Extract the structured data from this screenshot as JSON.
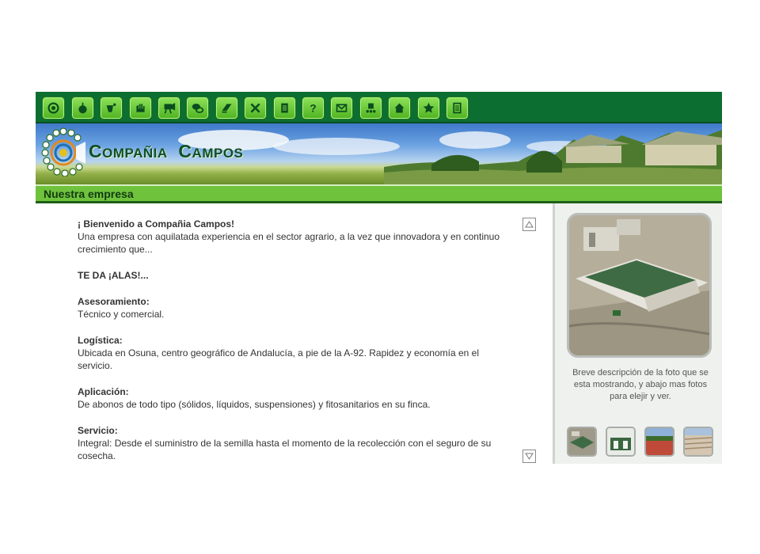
{
  "toolbar": {
    "icons": [
      "cc-logo-icon",
      "apple-icon",
      "tractor-icon",
      "glove-icon",
      "projector-icon",
      "chat-icon",
      "book-icon",
      "tools-icon",
      "document-icon",
      "help-icon",
      "mail-icon",
      "team-icon",
      "home-icon",
      "star-icon",
      "list-icon"
    ]
  },
  "banner": {
    "brand_1": "C",
    "brand_1_rest": "OMPAÑIA",
    "brand_2": "C",
    "brand_2_rest": "AMPOS"
  },
  "section": {
    "title": "Nuestra empresa"
  },
  "content": {
    "welcome_title": "¡ Bienvenido a Compañia Campos!",
    "welcome_text": "Una empresa con aquilatada experiencia en el sector agrario, a la vez que innovadora y en continuo crecimiento que...",
    "tagline": "TE DA ¡ALAS!...",
    "items": [
      {
        "title": "Asesoramiento:",
        "text": "Técnico y comercial."
      },
      {
        "title": "Logística:",
        "text": "Ubicada en Osuna, centro geográfico de Andalucía, a pie de la A-92. Rapidez y economía en el servicio."
      },
      {
        "title": "Aplicación:",
        "text": "De abonos de todo tipo (sólidos, líquidos, suspensiones) y fitosanitarios en su finca."
      },
      {
        "title": "Servicio:",
        "text": "Integral: Desde el suministro de la semilla hasta el momento de la recolección con el seguro de su cosecha."
      }
    ]
  },
  "side": {
    "caption": "Breve descripción de la foto que se esta mostrando, y abajo mas fotos para elejir y ver."
  },
  "colors": {
    "toolbar": "#0c6e30",
    "section_bar": "#6fc23c",
    "button": "#5cc22b"
  }
}
